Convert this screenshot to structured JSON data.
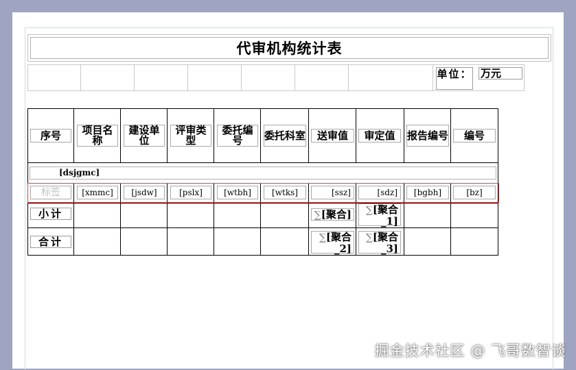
{
  "report": {
    "title": "代审机构统计表",
    "unit_label": "单位：",
    "unit_value": "万元",
    "columns": [
      "序号",
      "项目名称",
      "建设单位",
      "评审类型",
      "委托编号",
      "委托科室",
      "送审值",
      "审定值",
      "报告编号",
      "编号"
    ],
    "group_field": "[dsjgmc]",
    "detail_fields": [
      "标签",
      "[xmmc]",
      "[jsdw]",
      "[pslx]",
      "[wtbh]",
      "[wtks]",
      "[ssz]",
      "[sdz]",
      "[bgbh]",
      "[bz]"
    ],
    "subtotal_label": "小计",
    "total_label": "合计",
    "aggregates": {
      "sigma": "∑",
      "subtotal_ssz": "[聚合]",
      "subtotal_sdz": "[聚合_1]",
      "total_ssz": "[聚合_2]",
      "total_sdz": "[聚合_3]"
    }
  },
  "watermark": "掘金技术社区 @ 飞哥数智谈"
}
